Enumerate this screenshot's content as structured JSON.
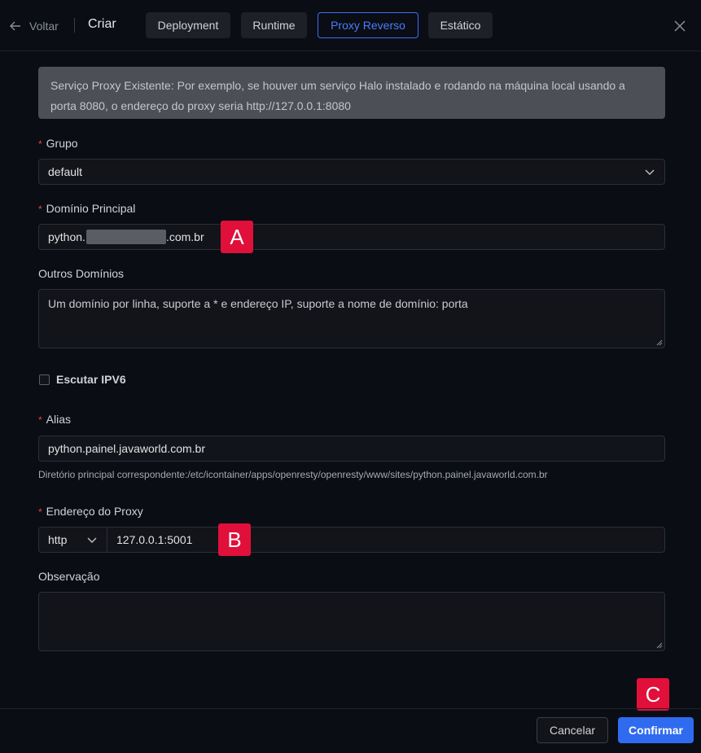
{
  "header": {
    "back_label": "Voltar",
    "title": "Criar",
    "tabs": [
      {
        "label": "Deployment",
        "active": false
      },
      {
        "label": "Runtime",
        "active": false
      },
      {
        "label": "Proxy Reverso",
        "active": true
      },
      {
        "label": "Estático",
        "active": false
      }
    ]
  },
  "notice": "Serviço Proxy Existente: Por exemplo, se houver um serviço Halo instalado e rodando na máquina local usando a porta 8080, o endereço do proxy seria http://127.0.0.1:8080",
  "form": {
    "required_mark": "*",
    "group": {
      "label": "Grupo",
      "value": "default"
    },
    "primary_domain": {
      "label": "Domínio Principal",
      "value_prefix": "python.",
      "value_suffix": ".com.br"
    },
    "other_domains": {
      "label": "Outros Domínios",
      "placeholder": "Um domínio por linha, suporte a * e endereço IP, suporte a nome de domínio: porta"
    },
    "ipv6": {
      "label": "Escutar IPV6",
      "checked": false
    },
    "alias": {
      "label": "Alias",
      "value": "python.painel.javaworld.com.br",
      "hint": "Diretório principal correspondente:/etc/icontainer/apps/openresty/openresty/www/sites/python.painel.javaworld.com.br"
    },
    "proxy": {
      "label": "Endereço do Proxy",
      "protocol": "http",
      "address": "127.0.0.1:5001"
    },
    "note": {
      "label": "Observação",
      "value": ""
    }
  },
  "annotations": {
    "a": "A",
    "b": "B",
    "c": "C"
  },
  "footer": {
    "cancel_label": "Cancelar",
    "confirm_label": "Confirmar"
  },
  "colors": {
    "accent": "#2f6bef",
    "badge": "#e0103a",
    "required": "#e5484d"
  }
}
